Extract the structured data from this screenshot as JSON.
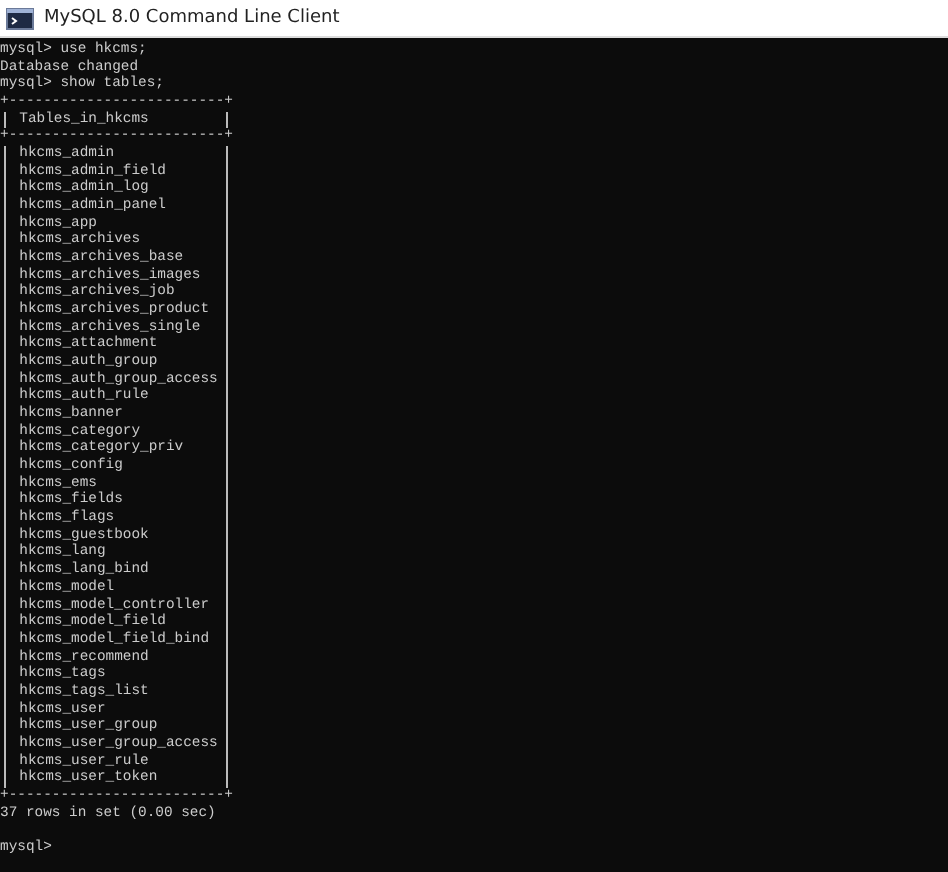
{
  "window": {
    "title": "MySQL 8.0 Command Line Client"
  },
  "console": {
    "before": [
      "mysql> use hkcms;",
      "Database changed",
      "mysql> show tables;"
    ],
    "table": {
      "border": "+-------------------------+",
      "header": "Tables_in_hkcms",
      "rows": [
        "hkcms_admin",
        "hkcms_admin_field",
        "hkcms_admin_log",
        "hkcms_admin_panel",
        "hkcms_app",
        "hkcms_archives",
        "hkcms_archives_base",
        "hkcms_archives_images",
        "hkcms_archives_job",
        "hkcms_archives_product",
        "hkcms_archives_single",
        "hkcms_attachment",
        "hkcms_auth_group",
        "hkcms_auth_group_access",
        "hkcms_auth_rule",
        "hkcms_banner",
        "hkcms_category",
        "hkcms_category_priv",
        "hkcms_config",
        "hkcms_ems",
        "hkcms_fields",
        "hkcms_flags",
        "hkcms_guestbook",
        "hkcms_lang",
        "hkcms_lang_bind",
        "hkcms_model",
        "hkcms_model_controller",
        "hkcms_model_field",
        "hkcms_model_field_bind",
        "hkcms_recommend",
        "hkcms_tags",
        "hkcms_tags_list",
        "hkcms_user",
        "hkcms_user_group",
        "hkcms_user_group_access",
        "hkcms_user_rule",
        "hkcms_user_token"
      ]
    },
    "result": "37 rows in set (0.00 sec)",
    "prompt": "mysql>"
  }
}
